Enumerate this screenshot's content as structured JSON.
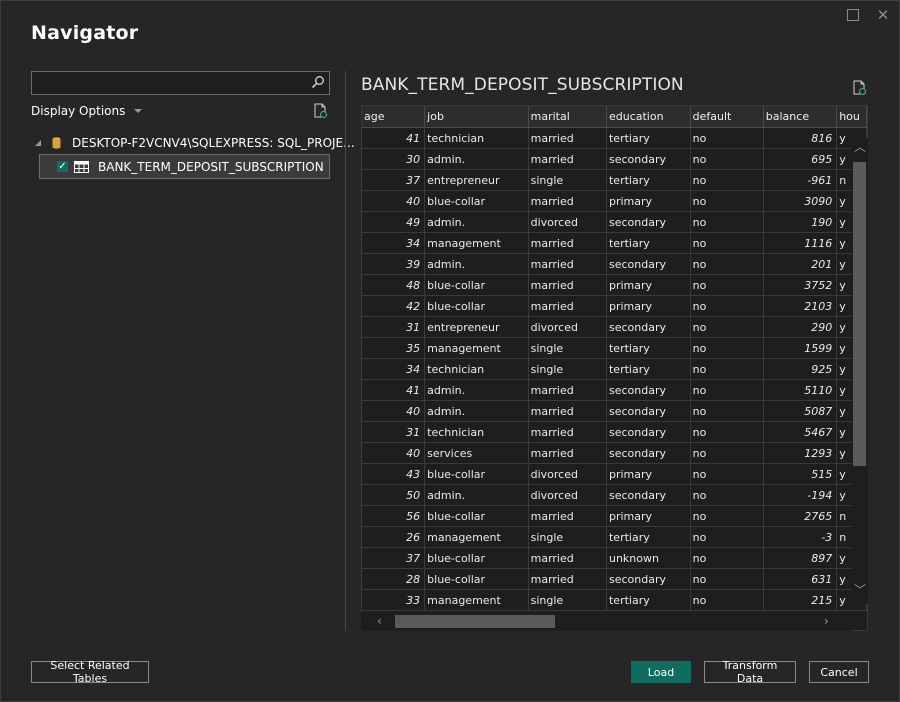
{
  "window": {
    "title": "Navigator"
  },
  "search": {
    "value": ""
  },
  "display_options": {
    "label": "Display Options"
  },
  "tree": {
    "server_label": "DESKTOP-F2VCNV4\\SQLEXPRESS: SQL_PROJE...",
    "table_label": "BANK_TERM_DEPOSIT_SUBSCRIPTION",
    "table_checked": true
  },
  "preview": {
    "title": "BANK_TERM_DEPOSIT_SUBSCRIPTION",
    "columns": [
      "age",
      "job",
      "marital",
      "education",
      "default",
      "balance",
      "hou"
    ],
    "rows": [
      [
        "41",
        "technician",
        "married",
        "tertiary",
        "no",
        "816",
        "y"
      ],
      [
        "30",
        "admin.",
        "married",
        "secondary",
        "no",
        "695",
        "y"
      ],
      [
        "37",
        "entrepreneur",
        "single",
        "tertiary",
        "no",
        "-961",
        "n"
      ],
      [
        "40",
        "blue-collar",
        "married",
        "primary",
        "no",
        "3090",
        "y"
      ],
      [
        "49",
        "admin.",
        "divorced",
        "secondary",
        "no",
        "190",
        "y"
      ],
      [
        "34",
        "management",
        "married",
        "tertiary",
        "no",
        "1116",
        "y"
      ],
      [
        "39",
        "admin.",
        "married",
        "secondary",
        "no",
        "201",
        "y"
      ],
      [
        "48",
        "blue-collar",
        "married",
        "primary",
        "no",
        "3752",
        "y"
      ],
      [
        "42",
        "blue-collar",
        "married",
        "primary",
        "no",
        "2103",
        "y"
      ],
      [
        "31",
        "entrepreneur",
        "divorced",
        "secondary",
        "no",
        "290",
        "y"
      ],
      [
        "35",
        "management",
        "single",
        "tertiary",
        "no",
        "1599",
        "y"
      ],
      [
        "34",
        "technician",
        "single",
        "tertiary",
        "no",
        "925",
        "y"
      ],
      [
        "41",
        "admin.",
        "married",
        "secondary",
        "no",
        "5110",
        "y"
      ],
      [
        "40",
        "admin.",
        "married",
        "secondary",
        "no",
        "5087",
        "y"
      ],
      [
        "31",
        "technician",
        "married",
        "secondary",
        "no",
        "5467",
        "y"
      ],
      [
        "40",
        "services",
        "married",
        "secondary",
        "no",
        "1293",
        "y"
      ],
      [
        "43",
        "blue-collar",
        "divorced",
        "primary",
        "no",
        "515",
        "y"
      ],
      [
        "50",
        "admin.",
        "divorced",
        "secondary",
        "no",
        "-194",
        "y"
      ],
      [
        "56",
        "blue-collar",
        "married",
        "primary",
        "no",
        "2765",
        "n"
      ],
      [
        "26",
        "management",
        "single",
        "tertiary",
        "no",
        "-3",
        "n"
      ],
      [
        "37",
        "blue-collar",
        "married",
        "unknown",
        "no",
        "897",
        "y"
      ],
      [
        "28",
        "blue-collar",
        "married",
        "secondary",
        "no",
        "631",
        "y"
      ],
      [
        "33",
        "management",
        "single",
        "tertiary",
        "no",
        "215",
        "y"
      ]
    ]
  },
  "buttons": {
    "select_related": "Select Related Tables",
    "load": "Load",
    "transform": "Transform Data",
    "cancel": "Cancel"
  },
  "colors": {
    "accent": "#0f6d5f",
    "background": "#262626"
  }
}
